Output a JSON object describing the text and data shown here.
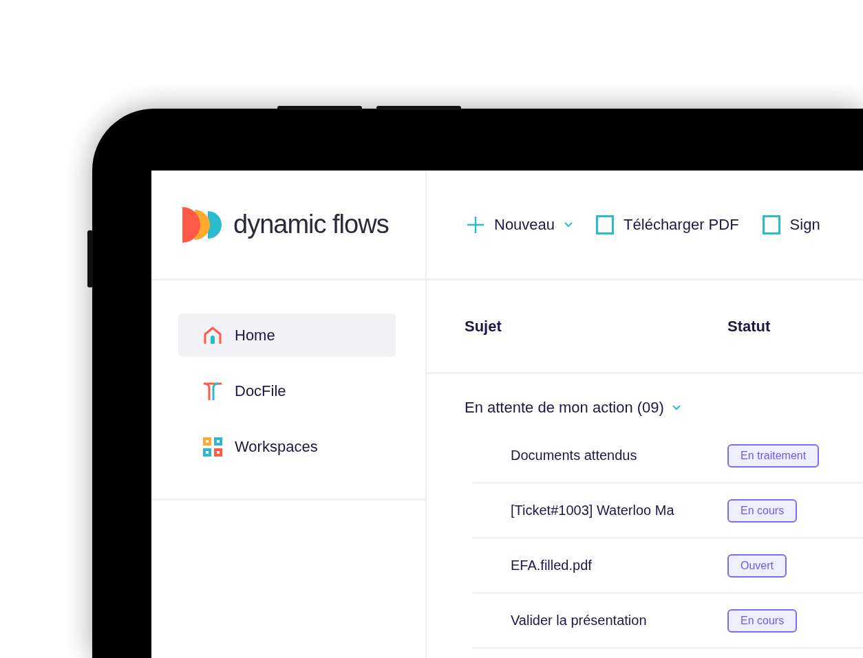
{
  "logo": {
    "text": "dynamic flows"
  },
  "sidebar": {
    "items": [
      {
        "label": "Home",
        "kind": "home",
        "selected": true
      },
      {
        "label": "DocFile",
        "kind": "docfile",
        "selected": false
      },
      {
        "label": "Workspaces",
        "kind": "workspaces",
        "selected": false
      }
    ]
  },
  "toolbar": [
    {
      "label": "Nouveau",
      "kind": "new"
    },
    {
      "label": "Télécharger PDF",
      "kind": "action"
    },
    {
      "label": "Sign",
      "kind": "action"
    }
  ],
  "table": {
    "columns": [
      "Sujet",
      "Statut"
    ],
    "groups": [
      {
        "title": "En attente de mon action (09)",
        "expanded": true,
        "rows": [
          {
            "subject": "Documents attendus",
            "status": "En traitement"
          },
          {
            "subject": "[Ticket#1003] Waterloo Ma",
            "status": "En cours"
          },
          {
            "subject": "EFA.filled.pdf",
            "status": "Ouvert"
          },
          {
            "subject": "Valider la présentation",
            "status": "En cours"
          }
        ]
      }
    ]
  }
}
